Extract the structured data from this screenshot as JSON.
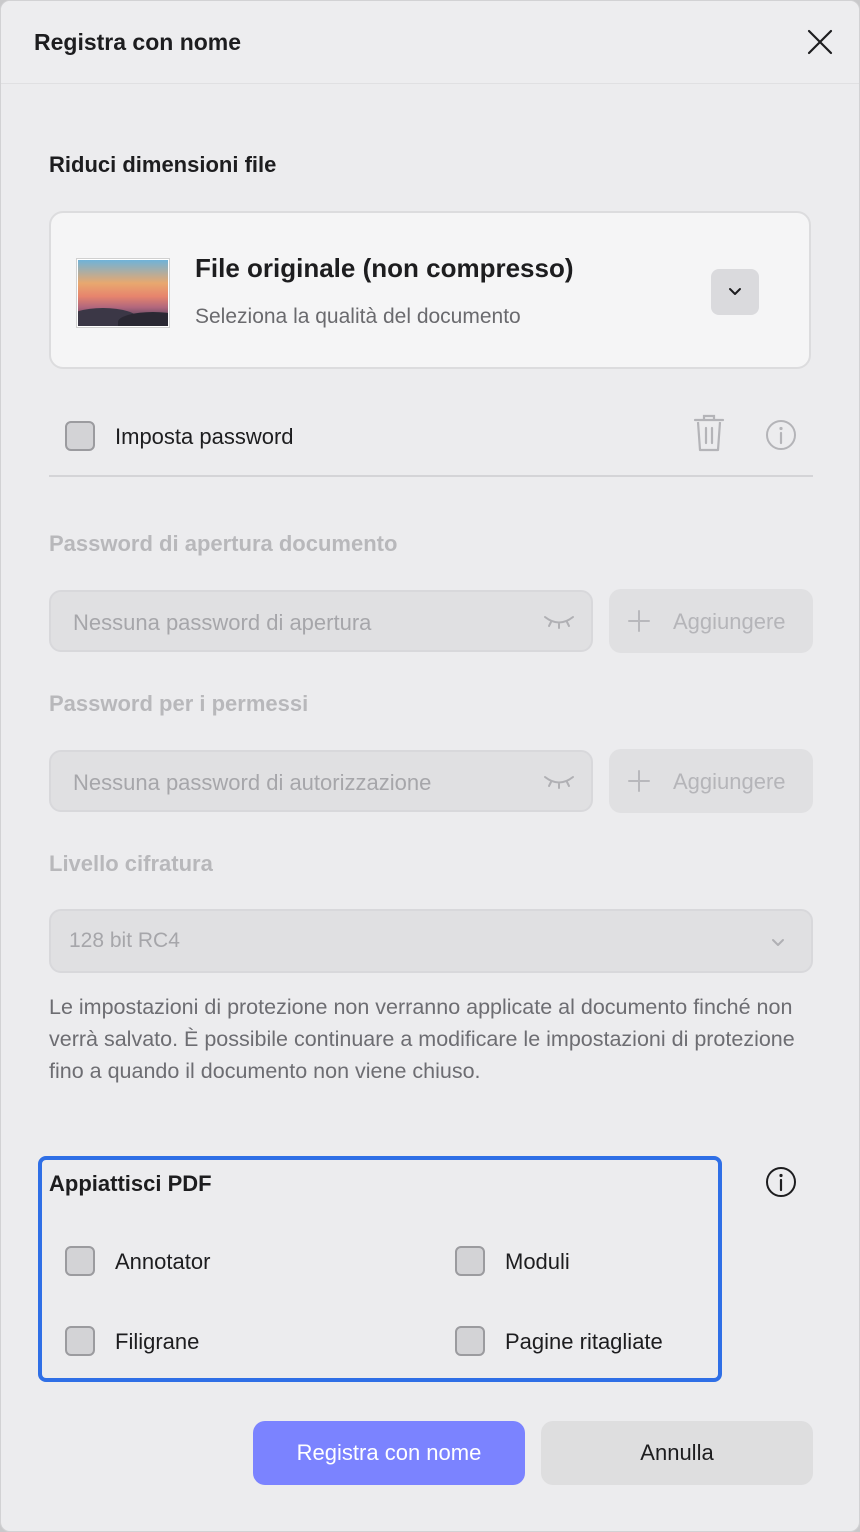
{
  "dialog": {
    "title": "Registra con nome",
    "close_icon": "close-icon"
  },
  "compression": {
    "heading": "Riduci dimensioni file",
    "selected_title": "File originale (non compresso)",
    "subtitle": "Seleziona la qualità del documento",
    "dropdown_icon": "chevron-down-icon"
  },
  "password": {
    "checkbox_label": "Imposta password",
    "checked": false,
    "delete_icon": "trash-icon",
    "info_icon": "info-icon",
    "open_section_label": "Password di apertura documento",
    "open_placeholder": "Nessuna password di apertura",
    "open_add_label": "Aggiungere",
    "perm_section_label": "Password per i permessi",
    "perm_placeholder": "Nessuna password di autorizzazione",
    "perm_add_label": "Aggiungere",
    "encryption_label": "Livello cifratura",
    "encryption_value": "128 bit RC4",
    "note": "Le impostazioni di protezione non verranno applicate al documento finché non verrà salvato. È possibile continuare a modificare le impostazioni di protezione fino a quando il documento non viene chiuso."
  },
  "flatten": {
    "heading": "Appiattisci PDF",
    "info_icon": "info-icon",
    "options": [
      {
        "label": "Annotator",
        "checked": false
      },
      {
        "label": "Moduli",
        "checked": false
      },
      {
        "label": "Filigrane",
        "checked": false
      },
      {
        "label": "Pagine ritagliate",
        "checked": false
      }
    ]
  },
  "footer": {
    "save_label": "Registra con nome",
    "cancel_label": "Annulla"
  },
  "colors": {
    "accent": "#7b83ff",
    "focus_outline": "#2f6fe6",
    "background": "#ececee",
    "disabled_text": "#b8b8bb"
  }
}
